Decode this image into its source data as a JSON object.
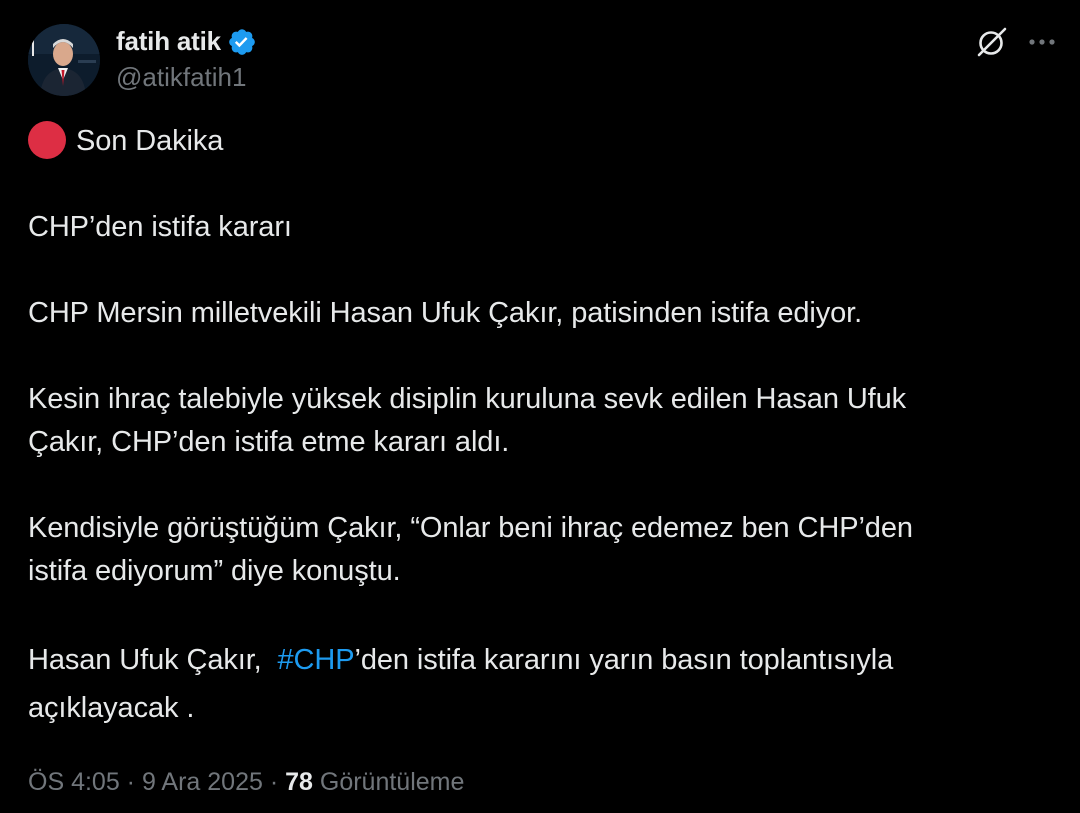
{
  "author": {
    "display_name": "fatih atik",
    "handle": "@atikfatih1",
    "verified": true,
    "verified_color": "#1d9bf0"
  },
  "icons": {
    "grok": "grok-icon",
    "more": "more-dots-icon",
    "breaking": "red-circle-icon"
  },
  "tweet": {
    "breaking_label": "Son Dakika",
    "headline": "CHP’den istifa kararı",
    "para1": "CHP Mersin milletvekili Hasan Ufuk Çakır, patisinden istifa ediyor.",
    "para2_line1": "Kesin ihraç talebiyle yüksek disiplin kuruluna sevk edilen Hasan Ufuk",
    "para2_line2": "Çakır, CHP’den istifa etme kararı aldı.",
    "para3_line1": "Kendisiyle görüştüğüm Çakır, “Onlar beni ihraç edemez ben CHP’den",
    "para3_line2": "istifa ediyorum” diye konuştu.",
    "para4_prefix": "Hasan Ufuk Çakır,  ",
    "para4_hashtag": "#CHP",
    "para4_suffix": "’den istifa kararını yarın basın toplantısıyla",
    "para4_line2": "açıklayacak ."
  },
  "meta": {
    "time": "ÖS 4:05",
    "separator": " · ",
    "date": "9 Ara 2025",
    "views_count": "78",
    "views_label": "Görüntüleme"
  },
  "colors": {
    "background": "#000000",
    "text": "#e7e9ea",
    "secondary": "#71767b",
    "link": "#1d9bf0",
    "breaking_dot": "#dd2e44"
  }
}
